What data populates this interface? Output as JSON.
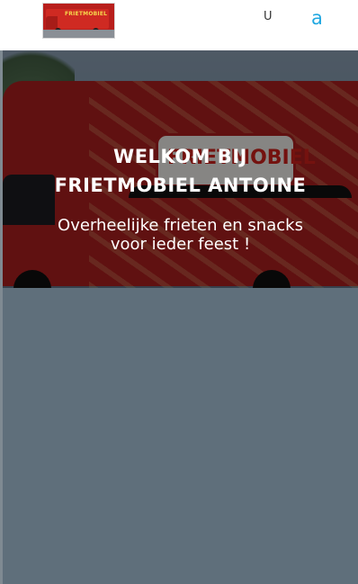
{
  "header": {
    "logo_text": "FRIETMOBIEL",
    "nav_u": "U",
    "nav_a": "a"
  },
  "hero": {
    "title_line1": "WELKOM BIJ",
    "title_line2": "FRIETMOBIEL ANTOINE",
    "subtitle_line1": "Overheelijke frieten en snacks",
    "subtitle_line2": "voor ieder feest !"
  }
}
